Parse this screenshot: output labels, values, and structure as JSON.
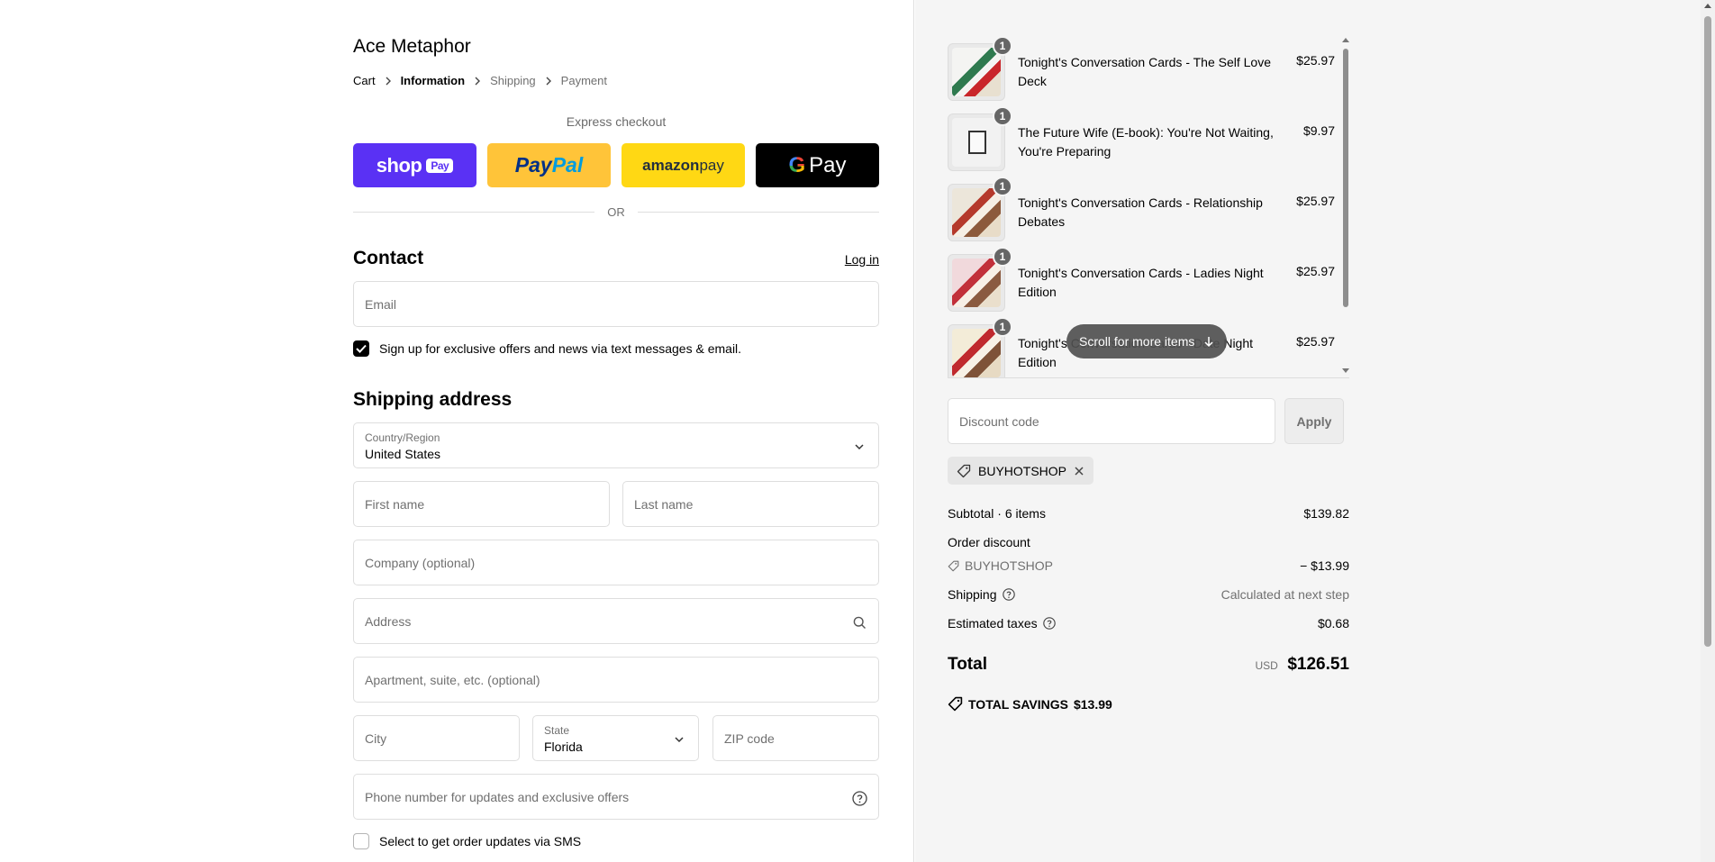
{
  "store": {
    "name": "Ace Metaphor"
  },
  "breadcrumb": [
    "Cart",
    "Information",
    "Shipping",
    "Payment"
  ],
  "express": {
    "title": "Express checkout",
    "shop_label": "shop",
    "shop_badge": "Pay",
    "paypal_a": "Pay",
    "paypal_b": "Pal",
    "amazon_a": "amazon",
    "amazon_b": " pay",
    "gpay_g": "G",
    "gpay_label": "Pay"
  },
  "or_text": "OR",
  "contact": {
    "title": "Contact",
    "login": "Log in",
    "email_placeholder": "Email",
    "signup_label": "Sign up for exclusive offers and news via text messages & email.",
    "signup_checked": true
  },
  "shipping": {
    "title": "Shipping address",
    "country_label": "Country/Region",
    "country_value": "United States",
    "first_name": "First name",
    "last_name": "Last name",
    "company": "Company (optional)",
    "address": "Address",
    "apartment": "Apartment, suite, etc. (optional)",
    "city": "City",
    "state_label": "State",
    "state_value": "Florida",
    "zip": "ZIP code",
    "phone": "Phone number for updates and exclusive offers",
    "sms_label": "Select to get order updates via SMS",
    "sms_checked": false
  },
  "items": [
    {
      "name": "Tonight's Conversation Cards - The Self Love Deck",
      "price": "$25.97",
      "qty": "1"
    },
    {
      "name": "The Future Wife (E-book): You're Not Waiting, You're Preparing",
      "price": "$9.97",
      "qty": "1"
    },
    {
      "name": "Tonight's Conversation Cards - Relationship Debates",
      "price": "$25.97",
      "qty": "1"
    },
    {
      "name": "Tonight's Conversation Cards - Ladies Night Edition",
      "price": "$25.97",
      "qty": "1"
    },
    {
      "name": "Tonight's Conversation Cards - Date Night Edition",
      "price": "$25.97",
      "qty": "1"
    }
  ],
  "scroll_hint": "Scroll for more items",
  "discount": {
    "placeholder": "Discount code",
    "apply": "Apply",
    "applied_code": "BUYHOTSHOP"
  },
  "summary": {
    "subtotal_label": "Subtotal · 6 items",
    "subtotal_value": "$139.82",
    "order_discount_label": "Order discount",
    "discount_code": "BUYHOTSHOP",
    "discount_value": "− $13.99",
    "shipping_label": "Shipping",
    "shipping_value": "Calculated at next step",
    "taxes_label": "Estimated taxes",
    "taxes_value": "$0.68",
    "total_label": "Total",
    "currency": "USD",
    "total_value": "$126.51",
    "savings_label": "TOTAL SAVINGS",
    "savings_value": "$13.99"
  },
  "colors": {
    "shop_pay": "#5a31f4",
    "paypal": "#ffc439",
    "amazon": "#ffd814",
    "gpay": "#000000",
    "summary_bg": "#f5f5f5"
  }
}
